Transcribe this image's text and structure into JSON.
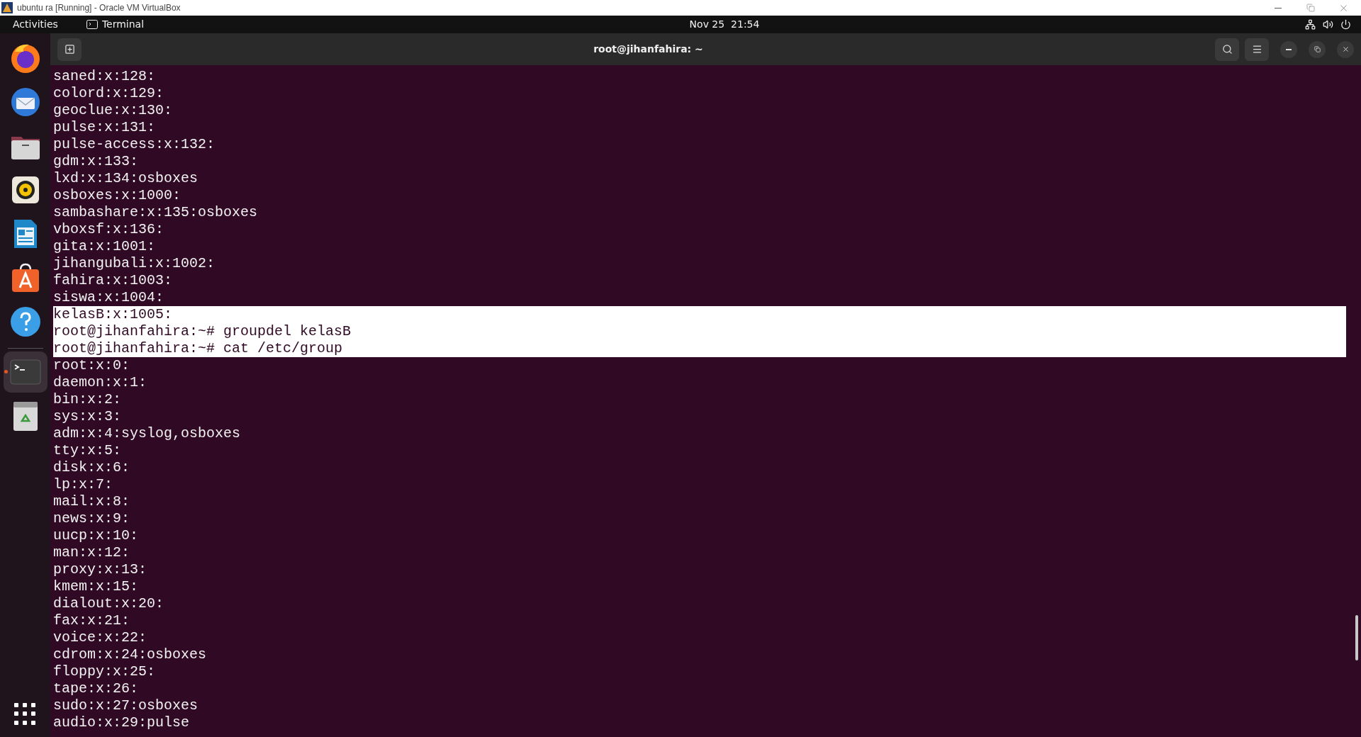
{
  "host_window": {
    "title": "ubuntu ra [Running] - Oracle VM VirtualBox"
  },
  "top_bar": {
    "activities": "Activities",
    "app_menu": "Terminal",
    "clock": "Nov 25  21:54"
  },
  "dock": {
    "items": [
      {
        "kind": "browser",
        "active": false
      },
      {
        "kind": "mail",
        "active": false
      },
      {
        "kind": "files",
        "active": false
      },
      {
        "kind": "music",
        "active": false
      },
      {
        "kind": "writer",
        "active": false
      },
      {
        "kind": "store",
        "active": false
      },
      {
        "kind": "help",
        "active": false
      },
      {
        "kind": "terminal",
        "active": true
      },
      {
        "kind": "trash",
        "active": false
      }
    ]
  },
  "terminal": {
    "title": "root@jihanfahira: ~",
    "lines": [
      {
        "text": "saned:x:128:",
        "selected": false
      },
      {
        "text": "colord:x:129:",
        "selected": false
      },
      {
        "text": "geoclue:x:130:",
        "selected": false
      },
      {
        "text": "pulse:x:131:",
        "selected": false
      },
      {
        "text": "pulse-access:x:132:",
        "selected": false
      },
      {
        "text": "gdm:x:133:",
        "selected": false
      },
      {
        "text": "lxd:x:134:osboxes",
        "selected": false
      },
      {
        "text": "osboxes:x:1000:",
        "selected": false
      },
      {
        "text": "sambashare:x:135:osboxes",
        "selected": false
      },
      {
        "text": "vboxsf:x:136:",
        "selected": false
      },
      {
        "text": "gita:x:1001:",
        "selected": false
      },
      {
        "text": "jihangubali:x:1002:",
        "selected": false
      },
      {
        "text": "fahira:x:1003:",
        "selected": false
      },
      {
        "text": "siswa:x:1004:",
        "selected": false
      },
      {
        "text": "kelasB:x:1005:",
        "selected": true
      },
      {
        "text": "root@jihanfahira:~# groupdel kelasB",
        "selected": true
      },
      {
        "text": "root@jihanfahira:~# cat /etc/group",
        "selected": true
      },
      {
        "text": "root:x:0:",
        "selected": false
      },
      {
        "text": "daemon:x:1:",
        "selected": false
      },
      {
        "text": "bin:x:2:",
        "selected": false
      },
      {
        "text": "sys:x:3:",
        "selected": false
      },
      {
        "text": "adm:x:4:syslog,osboxes",
        "selected": false
      },
      {
        "text": "tty:x:5:",
        "selected": false
      },
      {
        "text": "disk:x:6:",
        "selected": false
      },
      {
        "text": "lp:x:7:",
        "selected": false
      },
      {
        "text": "mail:x:8:",
        "selected": false
      },
      {
        "text": "news:x:9:",
        "selected": false
      },
      {
        "text": "uucp:x:10:",
        "selected": false
      },
      {
        "text": "man:x:12:",
        "selected": false
      },
      {
        "text": "proxy:x:13:",
        "selected": false
      },
      {
        "text": "kmem:x:15:",
        "selected": false
      },
      {
        "text": "dialout:x:20:",
        "selected": false
      },
      {
        "text": "fax:x:21:",
        "selected": false
      },
      {
        "text": "voice:x:22:",
        "selected": false
      },
      {
        "text": "cdrom:x:24:osboxes",
        "selected": false
      },
      {
        "text": "floppy:x:25:",
        "selected": false
      },
      {
        "text": "tape:x:26:",
        "selected": false
      },
      {
        "text": "sudo:x:27:osboxes",
        "selected": false
      },
      {
        "text": "audio:x:29:pulse",
        "selected": false
      }
    ]
  }
}
